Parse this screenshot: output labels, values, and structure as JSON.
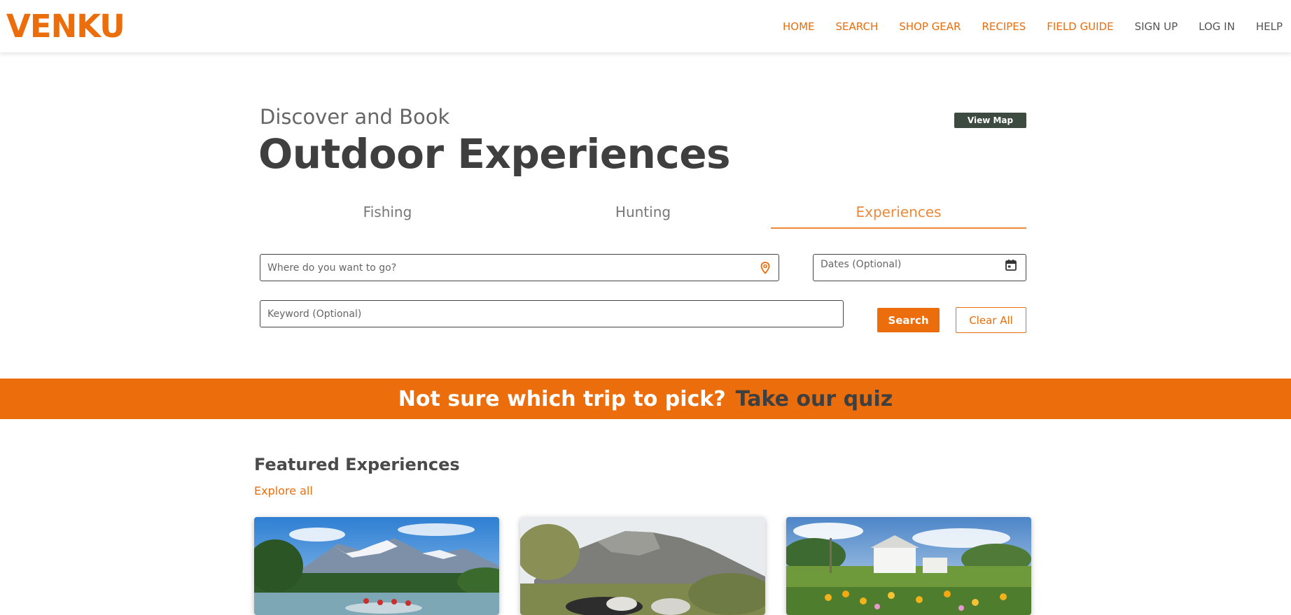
{
  "brand": {
    "logo": "VENKU",
    "accent": "#ec6d0b"
  },
  "nav": [
    {
      "label": "HOME",
      "color": "orange"
    },
    {
      "label": "SEARCH",
      "color": "orange"
    },
    {
      "label": "SHOP GEAR",
      "color": "orange"
    },
    {
      "label": "RECIPES",
      "color": "orange"
    },
    {
      "label": "FIELD GUIDE",
      "color": "orange"
    },
    {
      "label": "SIGN UP",
      "color": "gray"
    },
    {
      "label": "LOG IN",
      "color": "gray"
    },
    {
      "label": "HELP",
      "color": "gray"
    }
  ],
  "hero": {
    "subtitle": "Discover and Book",
    "title": "Outdoor Experiences",
    "view_map_label": "View Map"
  },
  "tabs": [
    {
      "label": "Fishing",
      "active": false
    },
    {
      "label": "Hunting",
      "active": false
    },
    {
      "label": "Experiences",
      "active": true
    }
  ],
  "search": {
    "where_placeholder": "Where do you want to go?",
    "where_value": "",
    "dates_placeholder": "Dates (Optional)",
    "dates_value": "",
    "keyword_placeholder": "Keyword (Optional)",
    "keyword_value": "",
    "search_label": "Search",
    "clear_label": "Clear All"
  },
  "banner": {
    "question": "Not sure which trip to pick?",
    "link": "Take our quiz"
  },
  "featured": {
    "title": "Featured Experiences",
    "explore_label": "Explore all",
    "cards": [
      {
        "image": "river-rafting-mountains-photo"
      },
      {
        "image": "horseback-mountain-trail-photo"
      },
      {
        "image": "farmhouse-wildflowers-photo"
      }
    ]
  }
}
